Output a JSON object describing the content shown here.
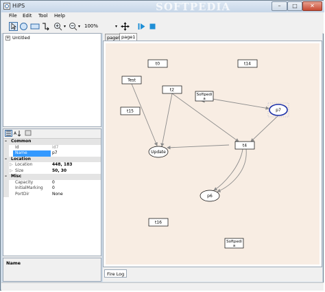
{
  "window": {
    "title": "HiPS",
    "watermark": "SOFTPEDIA"
  },
  "window_buttons": {
    "minimize": "–",
    "maximize": "□",
    "close": "✕"
  },
  "menu": {
    "items": [
      "File",
      "Edit",
      "Tool",
      "Help"
    ]
  },
  "toolbar": {
    "zoom": "100%",
    "icons": [
      "pointer-icon",
      "place-icon",
      "transition-icon",
      "arc-icon",
      "zoom-in-icon",
      "zoom-out-icon",
      "pan-icon",
      "play-icon",
      "stop-icon"
    ]
  },
  "tree": {
    "root_label": "Untitled",
    "expander": "+"
  },
  "properties": {
    "rows": [
      {
        "kind": "category",
        "name": "Common",
        "toggle": "–"
      },
      {
        "kind": "prop",
        "name": "Id",
        "value": "id7",
        "dim": true
      },
      {
        "kind": "prop",
        "name": "Name",
        "value": "p7",
        "selected": true
      },
      {
        "kind": "category",
        "name": "Location",
        "toggle": "–"
      },
      {
        "kind": "prop",
        "name": "Location",
        "value": "448, 183",
        "expandable": true,
        "bold": true
      },
      {
        "kind": "prop",
        "name": "Size",
        "value": "50, 30",
        "expandable": true,
        "bold": true
      },
      {
        "kind": "category",
        "name": "Misc",
        "toggle": "–"
      },
      {
        "kind": "prop",
        "name": "Capacity",
        "value": "0"
      },
      {
        "kind": "prop",
        "name": "InitialMarking",
        "value": "0"
      },
      {
        "kind": "prop",
        "name": "PortDir",
        "value": "None"
      }
    ],
    "description_title": "Name"
  },
  "tabs": [
    {
      "label": "page0",
      "active": false
    },
    {
      "label": "page1",
      "active": true
    }
  ],
  "firelog": {
    "label": "Fire Log"
  },
  "net": {
    "colors": {
      "arc": "#8c8c8c",
      "selected": "#1a2fa8",
      "box": "#000000"
    },
    "transitions": [
      {
        "id": "t0",
        "label": "t0"
      },
      {
        "id": "t14",
        "label": "t14"
      },
      {
        "id": "test",
        "label": "Test"
      },
      {
        "id": "t2",
        "label": "t2"
      },
      {
        "id": "softpedia1",
        "label": "Softpedia"
      },
      {
        "id": "t15",
        "label": "t15"
      },
      {
        "id": "t4",
        "label": "t4"
      },
      {
        "id": "t16",
        "label": "t16"
      },
      {
        "id": "softpedia2",
        "label": "Softpedia"
      }
    ],
    "places": [
      {
        "id": "p7",
        "label": "p7",
        "selected": true
      },
      {
        "id": "update",
        "label": "Update"
      },
      {
        "id": "p6",
        "label": "p6"
      }
    ]
  }
}
